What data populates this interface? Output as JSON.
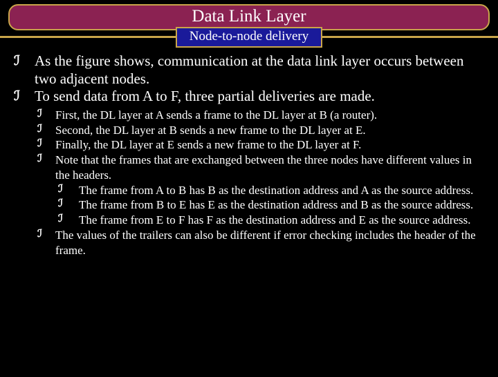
{
  "title": "Data Link Layer",
  "subtitle": "Node-to-node delivery",
  "bullet_glyph": "ℐ",
  "main": [
    "As the figure shows, communication at the data link layer occurs between two adjacent nodes.",
    "To send data from A to F, three partial deliveries are made."
  ],
  "sub": [
    "First, the DL layer at A sends a frame to the DL layer at B (a router).",
    "Second, the DL layer at B sends a new frame to the DL layer at E.",
    "Finally, the DL layer at E sends a new frame to the DL layer at F.",
    "Note that the frames that are exchanged between the three nodes have different values in the headers."
  ],
  "subsub": [
    "The frame from A to B has B as the destination address and A as the source address.",
    "The frame from B to E has E as the destination address and B as the source address.",
    "The frame from E to F has F as the destination address and E as the source address."
  ],
  "sub_tail": [
    "The values of the trailers can also be different if error checking includes the header of the frame."
  ]
}
